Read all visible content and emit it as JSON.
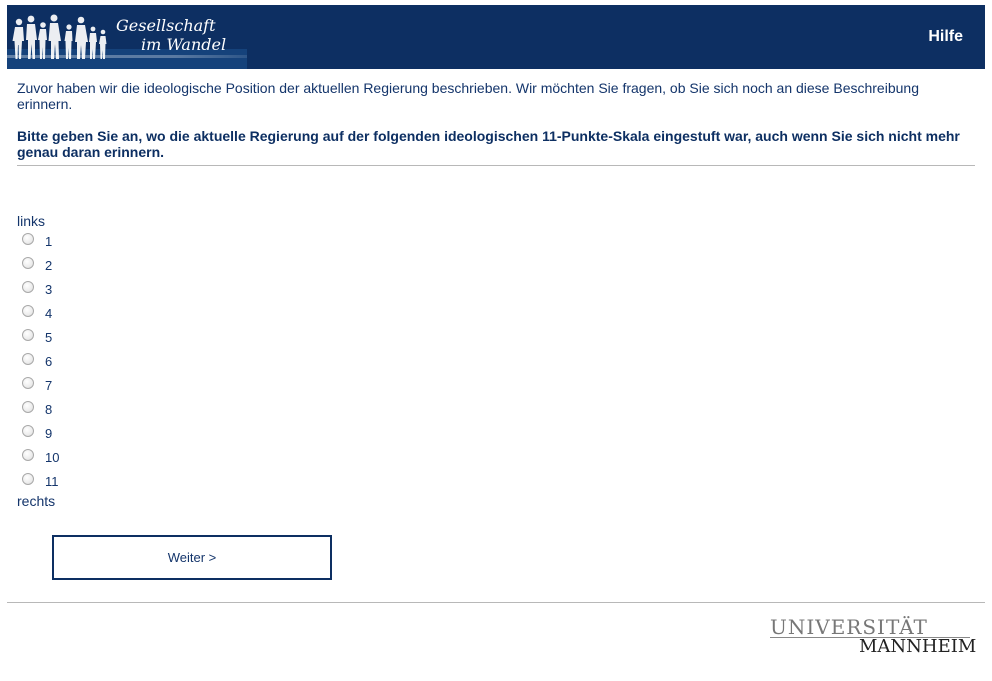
{
  "header": {
    "logo_line1": "Gesellschaft",
    "logo_line2": "im Wandel",
    "help_label": "Hilfe",
    "background_color": "#0d2f62"
  },
  "intro_text": "Zuvor haben wir die ideologische Position der aktuellen Regierung beschrieben. Wir möchten Sie fragen, ob Sie sich noch an diese Beschreibung erinnern.",
  "question_text": "Bitte geben Sie an, wo die aktuelle Regierung auf der folgenden ideologischen 11-Punkte-Skala eingestuft war, auch wenn Sie sich nicht mehr genau daran erinnern.",
  "scale": {
    "left_label": "links",
    "right_label": "rechts",
    "options": [
      "1",
      "2",
      "3",
      "4",
      "5",
      "6",
      "7",
      "8",
      "9",
      "10",
      "11"
    ],
    "selected": null
  },
  "next_button_label": "Weiter >",
  "footer": {
    "logo_line1": "UNIVERSITÄT",
    "logo_line2": "MANNHEIM"
  }
}
